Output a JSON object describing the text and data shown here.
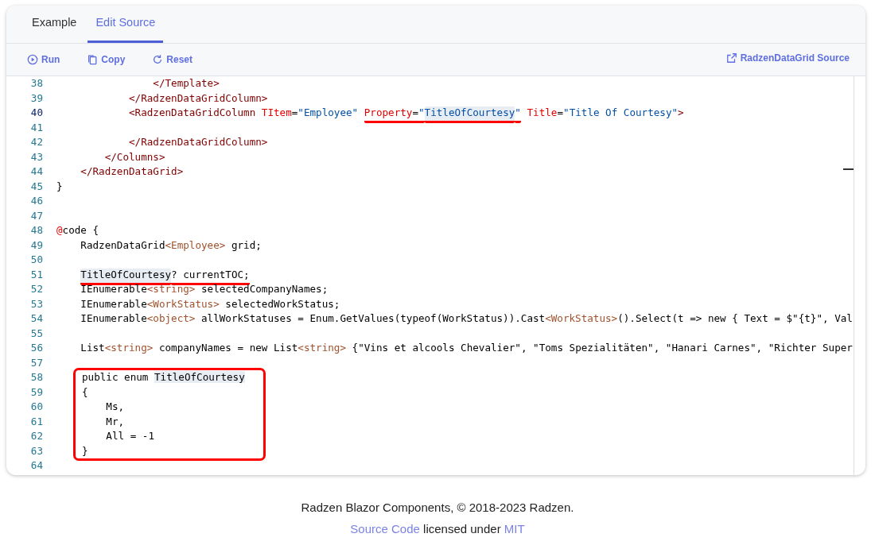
{
  "tabs": [
    {
      "label": "Example",
      "selected": false
    },
    {
      "label": "Edit Source",
      "selected": true
    }
  ],
  "toolbar": {
    "actions": [
      {
        "label": "Run",
        "kind": "run"
      },
      {
        "label": "Copy",
        "kind": "copy"
      },
      {
        "label": "Reset",
        "kind": "reset"
      }
    ],
    "source_link": {
      "label": "RadzenDataGrid Source"
    }
  },
  "editor": {
    "blocks": [
      {
        "boxed": false,
        "lines": [
          {
            "number": "38",
            "active": false,
            "segments": [
              {
                "underlined": false,
                "highlighted": false,
                "tokens": [
                  {
                    "text": "                </Template>",
                    "kind": "tag"
                  }
                ]
              }
            ]
          },
          {
            "number": "39",
            "active": false,
            "segments": [
              {
                "underlined": false,
                "highlighted": false,
                "tokens": [
                  {
                    "text": "            </RadzenDataGridColumn>",
                    "kind": "tag"
                  }
                ]
              }
            ]
          },
          {
            "number": "40",
            "active": true,
            "segments": [
              {
                "underlined": false,
                "highlighted": false,
                "tokens": [
                  {
                    "text": "            <RadzenDataGridColumn",
                    "kind": "tag"
                  },
                  {
                    "text": " TItem",
                    "kind": "attr"
                  },
                  {
                    "text": "=",
                    "kind": "plain"
                  },
                  {
                    "text": "\"Employee\"",
                    "kind": "string"
                  }
                ]
              },
              {
                "underlined": true,
                "highlighted": false,
                "tokens": [
                  {
                    "text": " Property",
                    "kind": "attr"
                  },
                  {
                    "text": "=",
                    "kind": "plain"
                  },
                  {
                    "text": "\"",
                    "kind": "string"
                  }
                ]
              },
              {
                "underlined": true,
                "highlighted": true,
                "tokens": [
                  {
                    "text": "TitleOfCourtesy",
                    "kind": "string"
                  }
                ]
              },
              {
                "underlined": true,
                "highlighted": false,
                "tokens": [
                  {
                    "text": "\"",
                    "kind": "string"
                  }
                ]
              },
              {
                "underlined": false,
                "highlighted": false,
                "tokens": [
                  {
                    "text": " Title",
                    "kind": "attr"
                  },
                  {
                    "text": "=",
                    "kind": "plain"
                  },
                  {
                    "text": "\"Title Of Courtesy\"",
                    "kind": "string"
                  },
                  {
                    "text": ">",
                    "kind": "tag"
                  }
                ]
              }
            ]
          },
          {
            "number": "41",
            "active": false
          },
          {
            "number": "42",
            "active": false,
            "segments": [
              {
                "underlined": false,
                "highlighted": false,
                "tokens": [
                  {
                    "text": "            </RadzenDataGridColumn>",
                    "kind": "tag"
                  }
                ]
              }
            ]
          },
          {
            "number": "43",
            "active": false,
            "segments": [
              {
                "underlined": false,
                "highlighted": false,
                "tokens": [
                  {
                    "text": "        </Columns>",
                    "kind": "tag"
                  }
                ]
              }
            ]
          },
          {
            "number": "44",
            "active": false,
            "segments": [
              {
                "underlined": false,
                "highlighted": false,
                "tokens": [
                  {
                    "text": "    </RadzenDataGrid>",
                    "kind": "tag"
                  }
                ]
              }
            ]
          },
          {
            "number": "45",
            "active": false,
            "segments": [
              {
                "underlined": false,
                "highlighted": false,
                "tokens": [
                  {
                    "text": "}",
                    "kind": "plain"
                  }
                ]
              }
            ]
          },
          {
            "number": "46",
            "active": false
          },
          {
            "number": "47",
            "active": false
          },
          {
            "number": "48",
            "active": false,
            "segments": [
              {
                "underlined": false,
                "highlighted": false,
                "tokens": [
                  {
                    "text": "@",
                    "kind": "attr"
                  },
                  {
                    "text": "code {",
                    "kind": "plain"
                  }
                ]
              }
            ]
          },
          {
            "number": "49",
            "active": false,
            "segments": [
              {
                "underlined": false,
                "highlighted": false,
                "tokens": [
                  {
                    "text": "    RadzenDataGrid",
                    "kind": "plain"
                  },
                  {
                    "text": "<Employee>",
                    "kind": "type"
                  },
                  {
                    "text": " grid;",
                    "kind": "plain"
                  }
                ]
              }
            ]
          },
          {
            "number": "50",
            "active": false
          },
          {
            "number": "51",
            "active": false,
            "segments": [
              {
                "underlined": true,
                "highlighted": true,
                "tokens": [
                  {
                    "text": "    TitleOfCourtesy",
                    "kind": "plain"
                  }
                ]
              },
              {
                "underlined": true,
                "highlighted": false,
                "tokens": [
                  {
                    "text": "? currentTOC;",
                    "kind": "plain"
                  }
                ]
              }
            ]
          },
          {
            "number": "52",
            "active": false,
            "segments": [
              {
                "underlined": false,
                "highlighted": false,
                "tokens": [
                  {
                    "text": "    IEnumerable",
                    "kind": "plain"
                  },
                  {
                    "text": "<string>",
                    "kind": "type"
                  },
                  {
                    "text": " selectedCompanyNames;",
                    "kind": "plain"
                  }
                ]
              }
            ]
          },
          {
            "number": "53",
            "active": false,
            "segments": [
              {
                "underlined": false,
                "highlighted": false,
                "tokens": [
                  {
                    "text": "    IEnumerable",
                    "kind": "plain"
                  },
                  {
                    "text": "<WorkStatus>",
                    "kind": "type"
                  },
                  {
                    "text": " selectedWorkStatus;",
                    "kind": "plain"
                  }
                ]
              }
            ]
          },
          {
            "number": "54",
            "active": false,
            "segments": [
              {
                "underlined": false,
                "highlighted": false,
                "tokens": [
                  {
                    "text": "    IEnumerable",
                    "kind": "plain"
                  },
                  {
                    "text": "<object>",
                    "kind": "type"
                  },
                  {
                    "text": " allWorkStatuses = Enum.GetValues(typeof(WorkStatus)).Cast",
                    "kind": "plain"
                  },
                  {
                    "text": "<WorkStatus>",
                    "kind": "type"
                  },
                  {
                    "text": "().Select(t => new { Text = $\"{t}\", Val",
                    "kind": "plain"
                  }
                ]
              }
            ]
          },
          {
            "number": "55",
            "active": false
          },
          {
            "number": "56",
            "active": false,
            "segments": [
              {
                "underlined": false,
                "highlighted": false,
                "tokens": [
                  {
                    "text": "    List",
                    "kind": "plain"
                  },
                  {
                    "text": "<string>",
                    "kind": "type"
                  },
                  {
                    "text": " companyNames = new List",
                    "kind": "plain"
                  },
                  {
                    "text": "<string>",
                    "kind": "type"
                  },
                  {
                    "text": " {\"Vins et alcools Chevalier\", \"Toms Spezialitäten\", \"Hanari Carnes\", \"Richter Super",
                    "kind": "plain"
                  }
                ]
              }
            ]
          },
          {
            "number": "57",
            "active": false
          }
        ]
      },
      {
        "boxed": true,
        "lines": [
          {
            "number": "58",
            "active": false,
            "segments": [
              {
                "underlined": false,
                "highlighted": false,
                "tokens": [
                  {
                    "text": "public enum",
                    "kind": "plain"
                  }
                ]
              },
              {
                "underlined": false,
                "highlighted": true,
                "tokens": [
                  {
                    "text": " TitleOfCourtesy",
                    "kind": "plain"
                  }
                ]
              }
            ]
          },
          {
            "number": "59",
            "active": false,
            "segments": [
              {
                "underlined": false,
                "highlighted": false,
                "tokens": [
                  {
                    "text": "{",
                    "kind": "plain"
                  }
                ]
              }
            ]
          },
          {
            "number": "60",
            "active": false,
            "segments": [
              {
                "underlined": false,
                "highlighted": false,
                "tokens": [
                  {
                    "text": "    Ms,",
                    "kind": "plain"
                  }
                ]
              }
            ]
          },
          {
            "number": "61",
            "active": false,
            "segments": [
              {
                "underlined": false,
                "highlighted": false,
                "tokens": [
                  {
                    "text": "    Mr,",
                    "kind": "plain"
                  }
                ]
              }
            ]
          },
          {
            "number": "62",
            "active": false,
            "segments": [
              {
                "underlined": false,
                "highlighted": false,
                "tokens": [
                  {
                    "text": "    All = -1",
                    "kind": "plain"
                  }
                ]
              }
            ]
          },
          {
            "number": "63",
            "active": false,
            "segments": [
              {
                "underlined": false,
                "highlighted": false,
                "tokens": [
                  {
                    "text": "}",
                    "kind": "plain"
                  }
                ]
              }
            ]
          }
        ]
      },
      {
        "boxed": false,
        "lines": [
          {
            "number": "64",
            "active": false
          }
        ]
      }
    ]
  },
  "footer": {
    "copyright": "Radzen Blazor Components, © 2018-2023 Radzen.",
    "license": [
      {
        "text": "Source Code",
        "kind": "link"
      },
      {
        "text": " licensed under ",
        "kind": "plain"
      },
      {
        "text": "MIT",
        "kind": "link"
      }
    ]
  }
}
